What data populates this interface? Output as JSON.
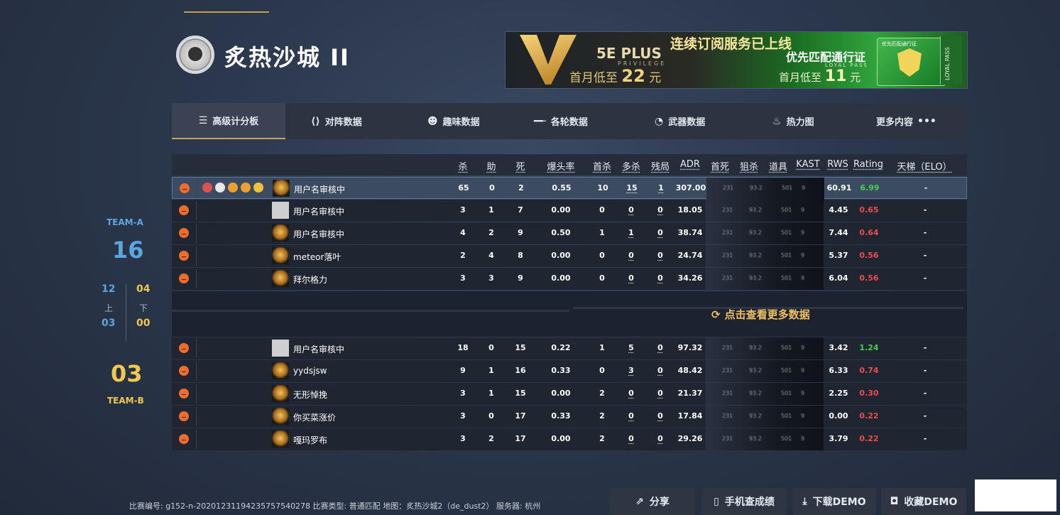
{
  "banner": {
    "plus_brand": "5E PLUS",
    "plus_sub": "PRIVILEGE",
    "month_prefix_1": "首月低至",
    "price_1": "22",
    "unit": "元",
    "headline": "连续订阅服务已上线",
    "loyal_title": "优先匹配通行证",
    "loyal_sub": "LOYAL PASS",
    "month_prefix_2": "首月低至",
    "price_2": "11",
    "card_title": "优先匹配通行证",
    "side_text": "LOYAL PASS"
  },
  "map": {
    "title": "炙热沙城 II"
  },
  "tabs": [
    {
      "label": "高级计分板",
      "icon": "menu-icon"
    },
    {
      "label": "对阵数据",
      "icon": "versus-icon"
    },
    {
      "label": "趣味数据",
      "icon": "smile-icon"
    },
    {
      "label": "各轮数据",
      "icon": "rifle-icon"
    },
    {
      "label": "武器数据",
      "icon": "pie-icon"
    },
    {
      "label": "热力图",
      "icon": "flame-icon"
    },
    {
      "label": "更多内容",
      "icon": "more-dots-icon"
    }
  ],
  "table": {
    "columns": [
      "杀",
      "助",
      "死",
      "爆头率",
      "首杀",
      "多杀",
      "残局",
      "ADR",
      "首死",
      "狙杀",
      "道具",
      "KAST",
      "RWS",
      "Rating",
      "天梯（ELO）"
    ],
    "blur_values": [
      "231",
      "93.2",
      "501",
      "9"
    ],
    "team_a_rows": [
      {
        "name": "用户名审核中",
        "kills": "65",
        "assists": "0",
        "deaths": "2",
        "hs": "0.55",
        "first_kills": "10",
        "multi": "15",
        "clutch": "1",
        "adr": "307.00",
        "rws": "60.91",
        "rating": "6.99",
        "elo": "-",
        "rating_color": "#45d04a",
        "avatar": "gold"
      },
      {
        "name": "用户名审核中",
        "kills": "3",
        "assists": "1",
        "deaths": "7",
        "hs": "0.00",
        "first_kills": "0",
        "multi": "0",
        "clutch": "0",
        "adr": "18.05",
        "rws": "4.45",
        "rating": "0.65",
        "elo": "-",
        "rating_color": "#ee4b4b",
        "avatar": "plain"
      },
      {
        "name": "用户名审核中",
        "kills": "4",
        "assists": "2",
        "deaths": "9",
        "hs": "0.50",
        "first_kills": "1",
        "multi": "1",
        "clutch": "0",
        "adr": "38.74",
        "rws": "7.44",
        "rating": "0.64",
        "elo": "-",
        "rating_color": "#ee4b4b",
        "avatar": "gold"
      },
      {
        "name": "meteor落叶",
        "kills": "2",
        "assists": "4",
        "deaths": "8",
        "hs": "0.00",
        "first_kills": "0",
        "multi": "0",
        "clutch": "0",
        "adr": "24.74",
        "rws": "5.37",
        "rating": "0.56",
        "elo": "-",
        "rating_color": "#ee4b4b",
        "avatar": "gold"
      },
      {
        "name": "拜尔格力",
        "kills": "3",
        "assists": "3",
        "deaths": "9",
        "hs": "0.00",
        "first_kills": "0",
        "multi": "0",
        "clutch": "0",
        "adr": "34.26",
        "rws": "6.04",
        "rating": "0.56",
        "elo": "-",
        "rating_color": "#ee4b4b",
        "avatar": "gold"
      }
    ],
    "more_link": "点击查看更多数据",
    "team_b_rows": [
      {
        "name": "用户名审核中",
        "kills": "18",
        "assists": "0",
        "deaths": "15",
        "hs": "0.22",
        "first_kills": "1",
        "multi": "5",
        "clutch": "0",
        "adr": "97.32",
        "rws": "3.42",
        "rating": "1.24",
        "elo": "-",
        "rating_color": "#45d04a",
        "avatar": "plain"
      },
      {
        "name": "yydsjsw",
        "kills": "9",
        "assists": "1",
        "deaths": "16",
        "hs": "0.33",
        "first_kills": "0",
        "multi": "3",
        "clutch": "0",
        "adr": "48.42",
        "rws": "6.33",
        "rating": "0.74",
        "elo": "-",
        "rating_color": "#ee4b4b",
        "avatar": "gold"
      },
      {
        "name": "无形悼挽",
        "kills": "3",
        "assists": "1",
        "deaths": "15",
        "hs": "0.00",
        "first_kills": "2",
        "multi": "0",
        "clutch": "0",
        "adr": "21.37",
        "rws": "2.25",
        "rating": "0.30",
        "elo": "-",
        "rating_color": "#ee4b4b",
        "avatar": "gold"
      },
      {
        "name": "你买菜涨价",
        "kills": "3",
        "assists": "0",
        "deaths": "17",
        "hs": "0.33",
        "first_kills": "2",
        "multi": "0",
        "clutch": "0",
        "adr": "17.84",
        "rws": "0.00",
        "rating": "0.22",
        "elo": "-",
        "rating_color": "#ee4b4b",
        "avatar": "gold"
      },
      {
        "name": "嘎玛罗布",
        "kills": "3",
        "assists": "2",
        "deaths": "17",
        "hs": "0.00",
        "first_kills": "2",
        "multi": "0",
        "clutch": "0",
        "adr": "29.26",
        "rws": "3.79",
        "rating": "0.22",
        "elo": "-",
        "rating_color": "#ee4b4b",
        "avatar": "gold"
      }
    ]
  },
  "score": {
    "team_a_label": "TEAM-A",
    "team_a_score": "16",
    "first_half_a": "12",
    "second_half_a": "04",
    "first_half_label": "上",
    "second_half_label": "下",
    "first_half_b": "03",
    "second_half_b": "00",
    "team_b_score": "03",
    "team_b_label": "TEAM-B"
  },
  "footer": {
    "info": "比赛编号: g152-n-20201231194235757540278 比赛类型: 普通匹配 地图：炙热沙城2（de_dust2） 服务器: 杭州",
    "share": "分享",
    "mobile": "手机查成绩",
    "download": "下载DEMO",
    "favorite": "收藏DEMO"
  }
}
